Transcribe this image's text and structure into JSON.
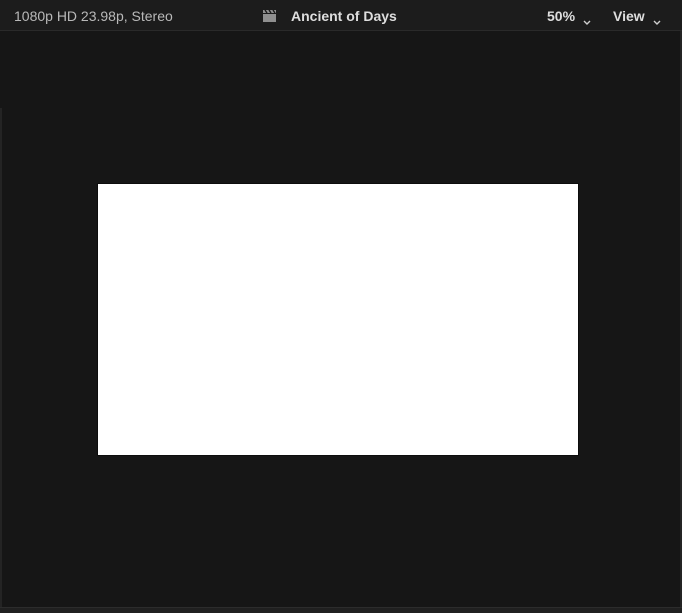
{
  "header": {
    "format_label": "1080p HD 23.98p, Stereo",
    "project_title": "Ancient of Days",
    "title_icon": "clapper-icon",
    "zoom_label": "50%",
    "view_label": "View"
  },
  "viewer": {
    "frame_color": "#ffffff",
    "background_color": "#161616"
  }
}
